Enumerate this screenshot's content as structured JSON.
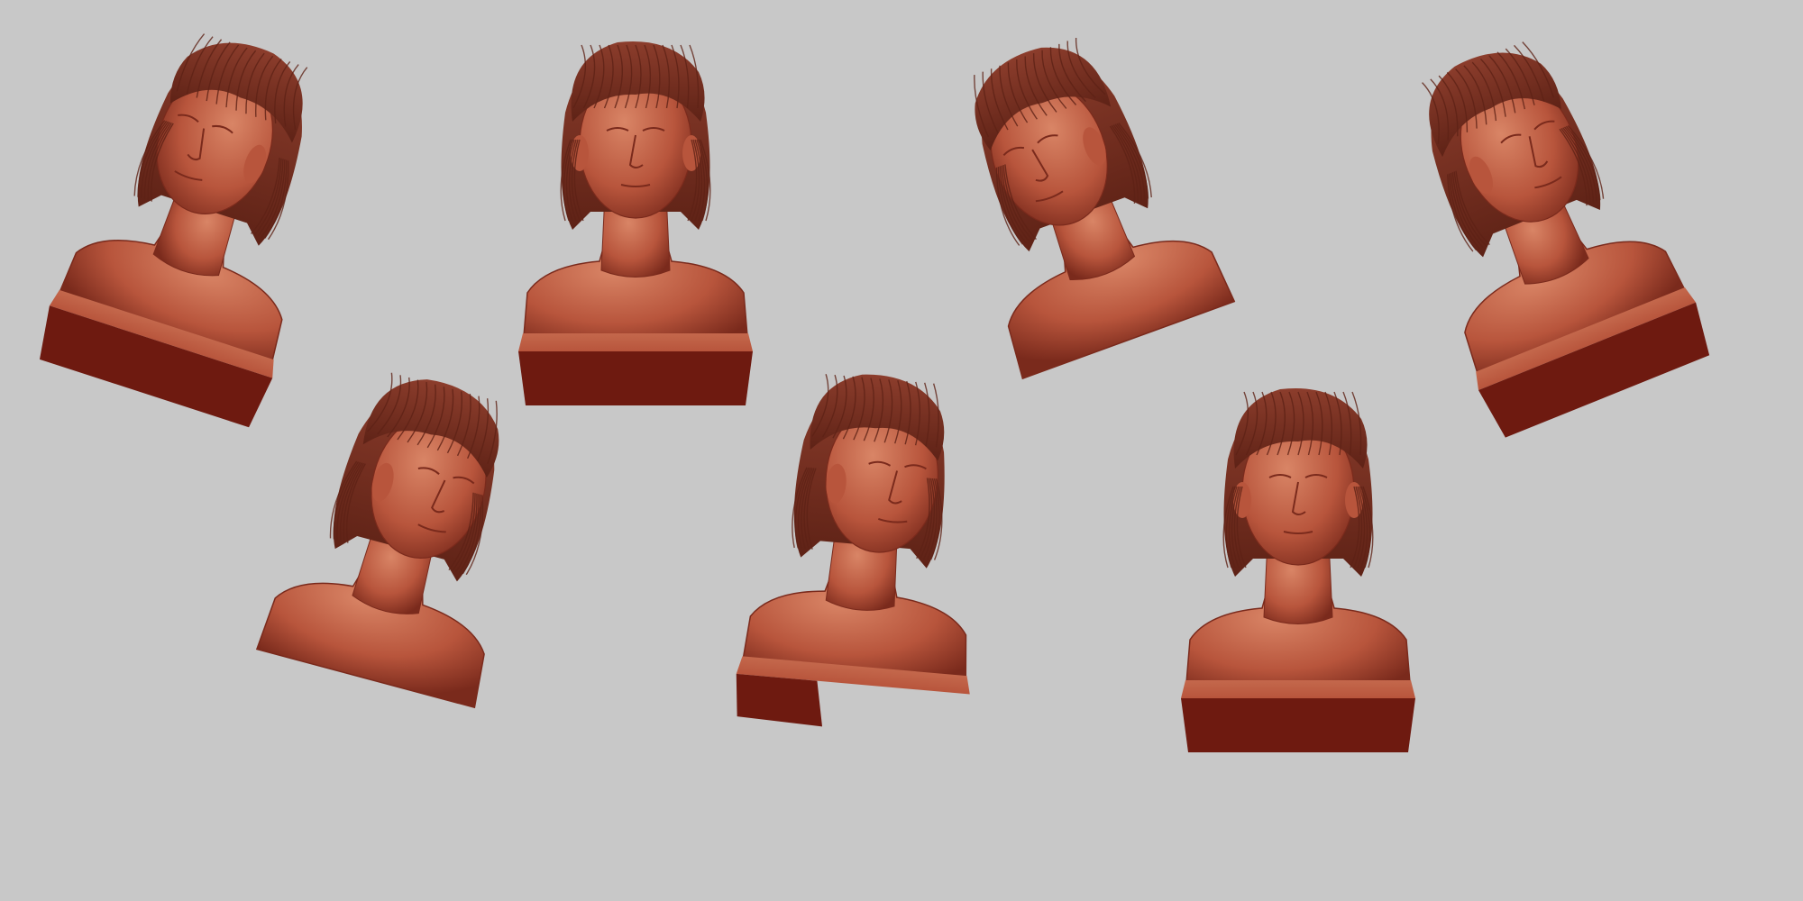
{
  "scene": {
    "background_color": "#c8c8c8",
    "clay_colors": {
      "skin_light": "#d98566",
      "skin_mid": "#b8553c",
      "skin_dark": "#7a2a1c",
      "hair": "#8c3d2c",
      "hair_line": "#5e2216",
      "base_top": "#c4684c",
      "base_side": "#6e1a10"
    },
    "busts": [
      {
        "view": "left-profile-tilted-up"
      },
      {
        "view": "front-looking-up"
      },
      {
        "view": "left-three-quarter-looking-down"
      },
      {
        "view": "right-three-quarter-tilted-up"
      },
      {
        "view": "right-three-quarter-looking-down"
      },
      {
        "view": "right-three-quarter"
      },
      {
        "view": "front"
      }
    ]
  }
}
